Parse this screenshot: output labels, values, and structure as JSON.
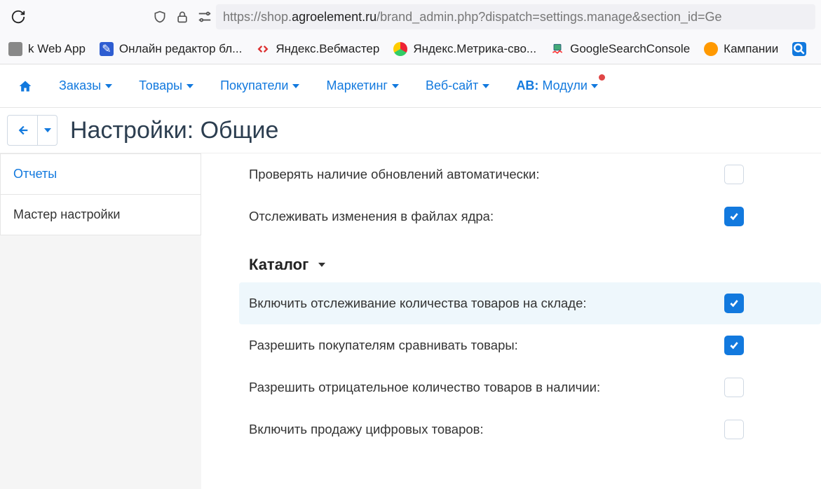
{
  "browser": {
    "url_prefix": "https://shop.",
    "url_domain": "agroelement.ru",
    "url_path": "/brand_admin.php?dispatch=settings.manage&section_id=Ge"
  },
  "bookmarks": [
    {
      "label": "k Web App",
      "icon": "gray-box"
    },
    {
      "label": "Онлайн редактор бл...",
      "icon": "blue-box"
    },
    {
      "label": "Яндекс.Вебмастер",
      "icon": "webmaster"
    },
    {
      "label": "Яндекс.Метрика-сво...",
      "icon": "metrika"
    },
    {
      "label": "GoogleSearchConsole",
      "icon": "gsc"
    },
    {
      "label": "Кампании",
      "icon": "orange"
    }
  ],
  "nav": {
    "orders": "Заказы",
    "products": "Товары",
    "customers": "Покупатели",
    "marketing": "Маркетинг",
    "website": "Веб-сайт",
    "ab_prefix": "AB:",
    "modules": "Модули"
  },
  "page_title": "Настройки: Общие",
  "sidebar": {
    "reports": "Отчеты",
    "wizard": "Мастер настройки"
  },
  "settings": {
    "update_auto": {
      "label": "Проверять наличие обновлений автоматически:",
      "checked": false
    },
    "track_core": {
      "label": "Отслеживать изменения в файлах ядра:",
      "checked": true
    },
    "section_catalog": "Каталог",
    "inventory": {
      "label": "Включить отслеживание количества товаров на складе:",
      "checked": true
    },
    "compare": {
      "label": "Разрешить покупателям сравнивать товары:",
      "checked": true
    },
    "negative": {
      "label": "Разрешить отрицательное количество товаров в наличии:",
      "checked": false
    },
    "digital": {
      "label": "Включить продажу цифровых товаров:",
      "checked": false
    }
  }
}
